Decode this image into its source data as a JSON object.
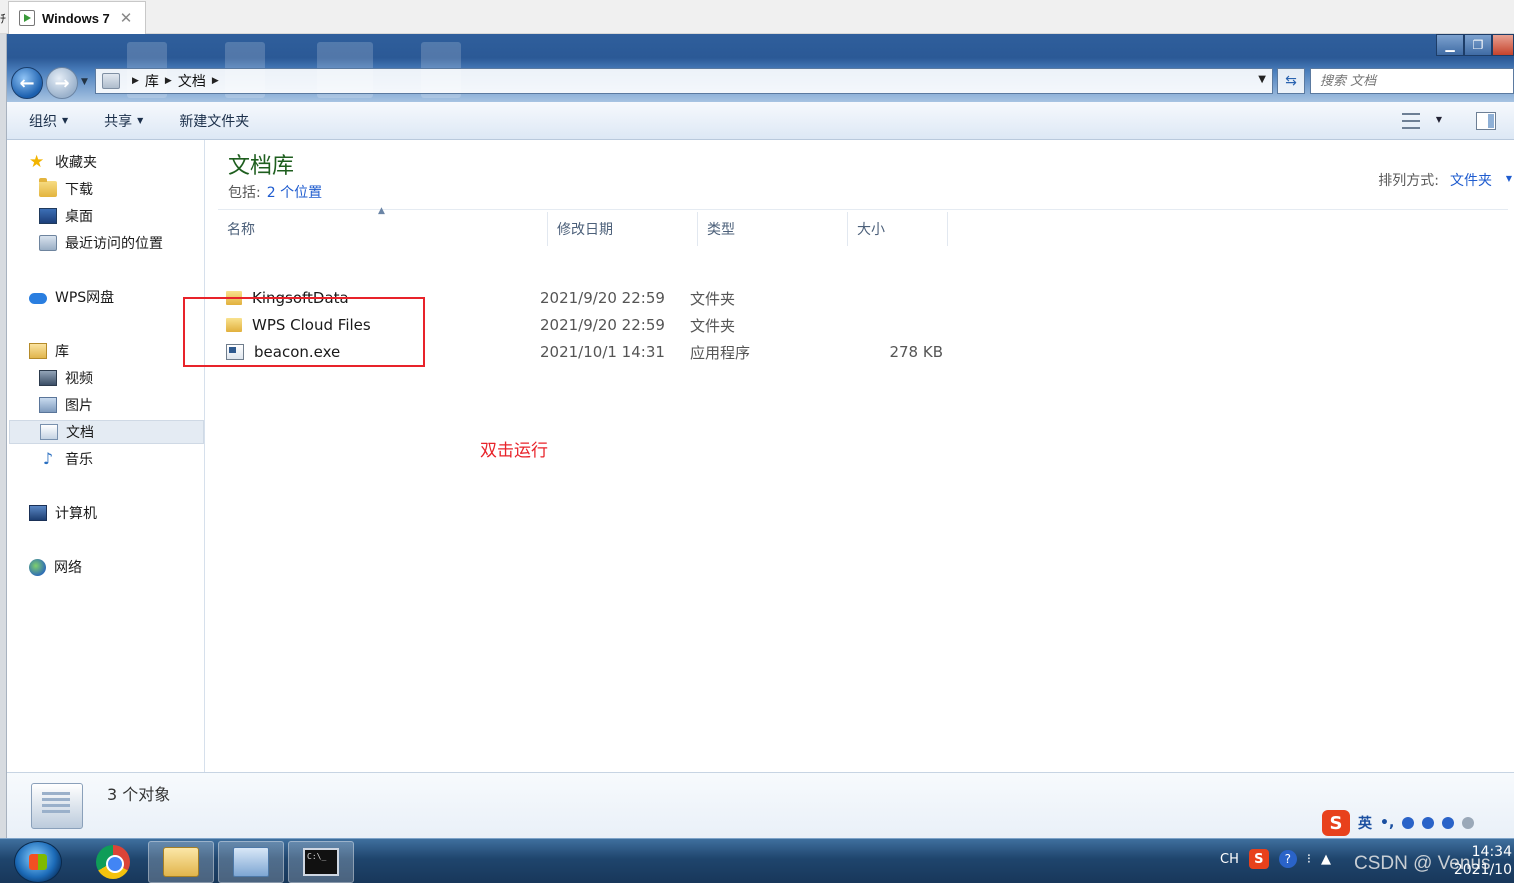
{
  "vm": {
    "tab_label": "Windows 7",
    "close_glyph": "✕",
    "edge_mark": "ﾁ"
  },
  "address": {
    "crumbs": [
      "库",
      "文档"
    ]
  },
  "search": {
    "placeholder": "搜索 文档"
  },
  "toolbar": {
    "organize": "组织",
    "share": "共享",
    "new_folder": "新建文件夹"
  },
  "nav": {
    "favorites": "收藏夹",
    "downloads": "下载",
    "desktop": "桌面",
    "recent": "最近访问的位置",
    "wps": "WPS网盘",
    "libraries": "库",
    "videos": "视频",
    "pictures": "图片",
    "documents": "文档",
    "music": "音乐",
    "computer": "计算机",
    "network": "网络"
  },
  "library": {
    "title": "文档库",
    "includes_label": "包括:",
    "includes_link": "2 个位置",
    "sort_label": "排列方式:",
    "sort_value": "文件夹"
  },
  "columns": {
    "name": "名称",
    "date": "修改日期",
    "type": "类型",
    "size": "大小"
  },
  "files": [
    {
      "name": "KingsoftData",
      "date": "2021/9/20 22:59",
      "type": "文件夹",
      "size": "",
      "icon": "folder-icon"
    },
    {
      "name": "WPS Cloud Files",
      "date": "2021/9/20 22:59",
      "type": "文件夹",
      "size": "",
      "icon": "folder-icon"
    },
    {
      "name": "beacon.exe",
      "date": "2021/10/1 14:31",
      "type": "应用程序",
      "size": "278 KB",
      "icon": "exe-icon"
    }
  ],
  "annotation": {
    "text": "双击运行",
    "color": "#e8232a"
  },
  "details": {
    "count": "3 个对象"
  },
  "ime": {
    "lang": "英"
  },
  "tray": {
    "lang": "CH"
  },
  "clock": {
    "time": "14:34",
    "date": "2021/10"
  },
  "watermark": "CSDN @ Venus"
}
